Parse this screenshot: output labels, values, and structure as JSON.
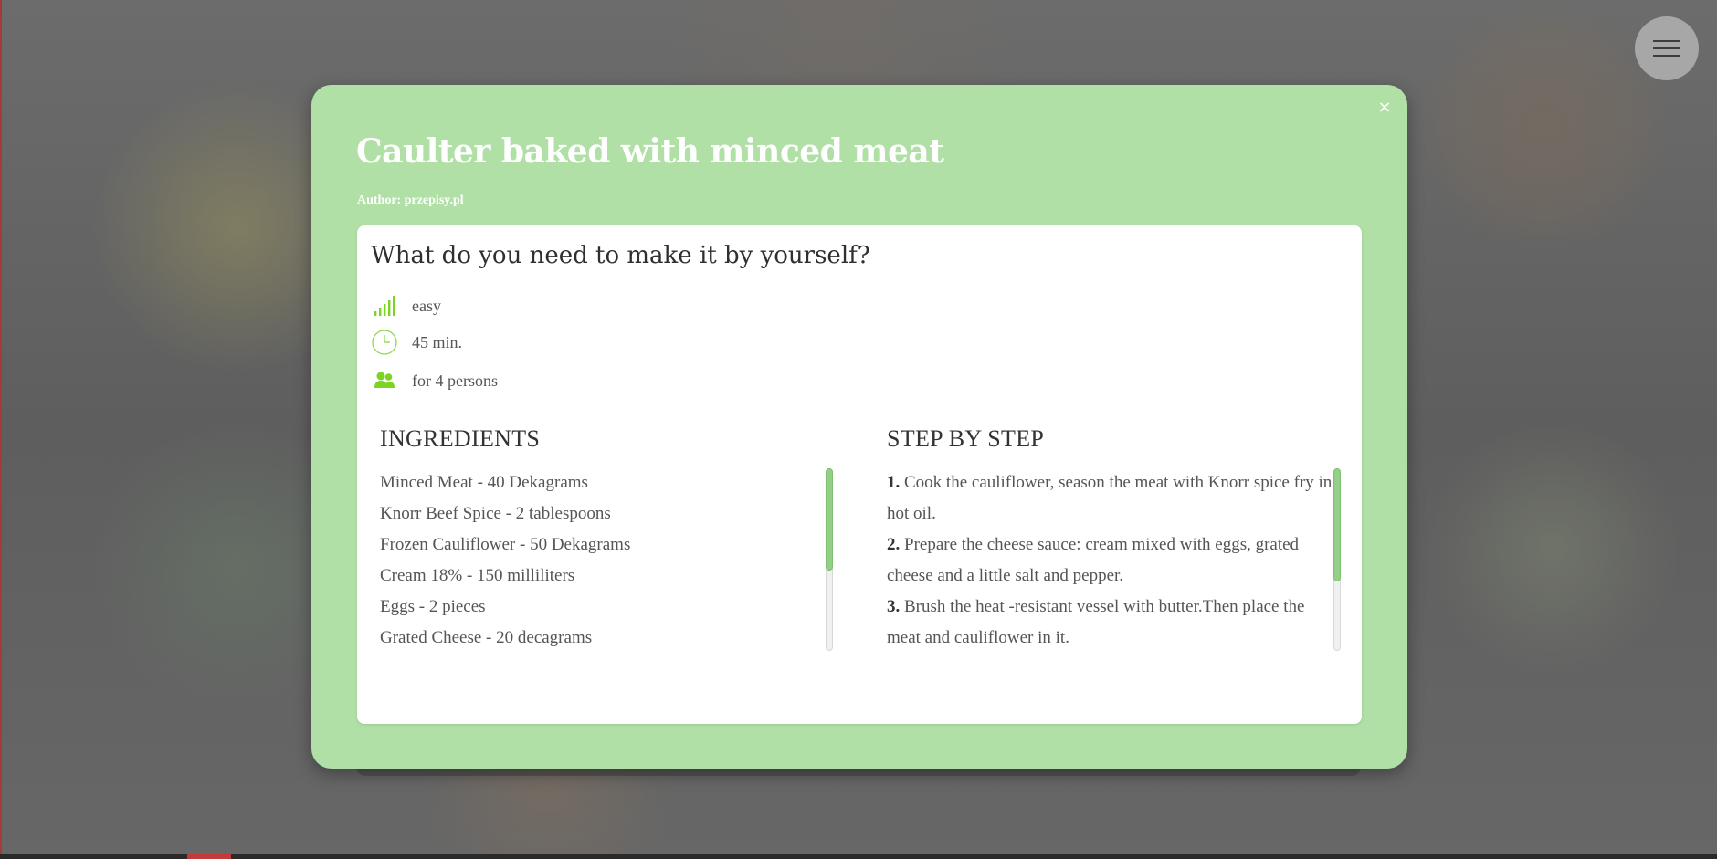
{
  "recipe": {
    "title": "Caulter baked with minced meat",
    "author": "Author: przepisy.pl",
    "close_symbol": "×"
  },
  "requirements": {
    "heading": "What do you need to make it by yourself?",
    "difficulty": {
      "icon": "signal-bars-icon",
      "text": "easy"
    },
    "time": {
      "icon": "clock-icon",
      "text": "45 min."
    },
    "servings": {
      "icon": "people-icon",
      "text": "for 4 persons"
    }
  },
  "ingredients": {
    "heading": "INGREDIENTS",
    "items": [
      "Minced Meat - 40 Dekagrams",
      "Knorr Beef Spice - 2 tablespoons",
      "Frozen Cauliflower - 50 Dekagrams",
      "Cream 18% - 150 milliliters",
      "Eggs - 2 pieces",
      "Grated Cheese - 20 decagrams"
    ]
  },
  "steps": {
    "heading": "STEP BY STEP",
    "items": [
      {
        "number": "1.",
        "text": "Cook the cauliflower, season the meat with Knorr spice fry in hot oil."
      },
      {
        "number": "2.",
        "text": "Prepare the cheese sauce: cream mixed with eggs, grated cheese and a little salt and pepper."
      },
      {
        "number": "3.",
        "text": "Brush the heat -resistant vessel with butter.Then place the meat and cauliflower in it."
      }
    ]
  },
  "colors": {
    "modal_bg": "#b1e0a7",
    "icon_green": "#7dd321",
    "scroll_thumb": "#93cf88"
  },
  "menu": {
    "icon": "hamburger-menu-icon"
  }
}
